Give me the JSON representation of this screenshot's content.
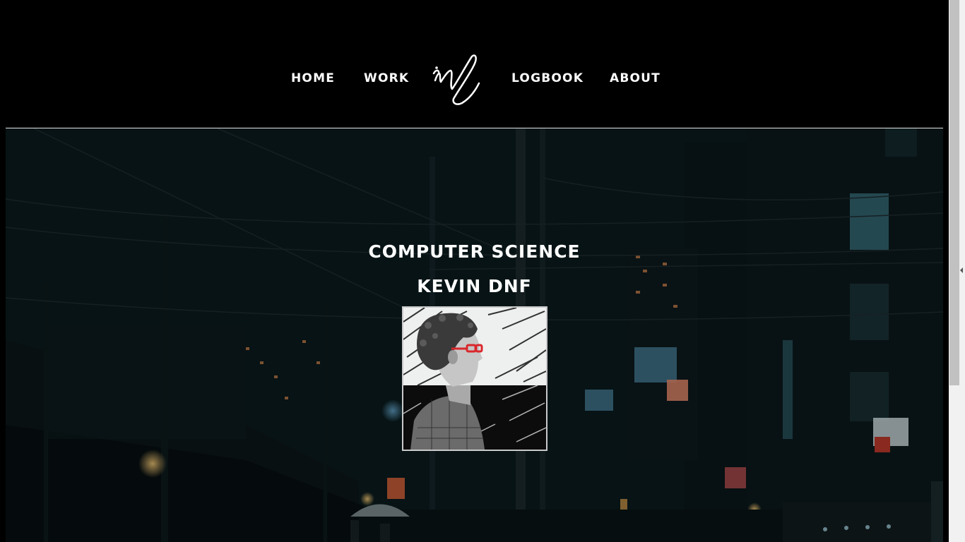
{
  "nav": {
    "home": "HOME",
    "work": "WORK",
    "logbook": "LOGBOOK",
    "about": "ABOUT",
    "logo_icon": "signature-logo-icon"
  },
  "hero": {
    "title": "COMPUTER SCIENCE",
    "name": "KEVIN DNF",
    "portrait_icon": "portrait-illustration"
  },
  "colors": {
    "background": "#000000",
    "text": "#ffffff",
    "accent_glasses": "#d9262b",
    "rule": "#e6e6e6"
  }
}
